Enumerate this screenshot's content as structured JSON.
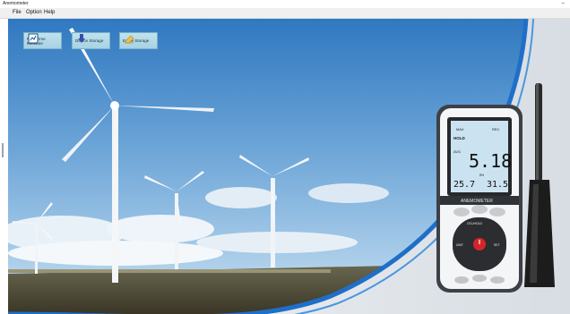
{
  "window": {
    "title": "Anemometer",
    "minimize_glyph": "–"
  },
  "menu": [
    {
      "label": "File"
    },
    {
      "label": "Option"
    },
    {
      "label": "Help"
    }
  ],
  "toolbar": [
    {
      "label": "Real Time Measure",
      "icon": "realtime-measure-icon"
    },
    {
      "label": "Device Storage",
      "icon": "device-storage-icon"
    },
    {
      "label": "Erase Storage",
      "icon": "erase-storage-icon"
    }
  ],
  "device": {
    "brand": "ANEMOMETER",
    "primary_reading": "5.18",
    "temperature_reading": "25.7",
    "secondary_reading": "31.5",
    "labels": {
      "max": "MAX",
      "rec": "REC",
      "avg": "AVG",
      "hold": "HOLD",
      "rh": "RH"
    },
    "buttons": {
      "cel_hold": "CEL/HOLD",
      "unit": "UNIT",
      "dir_btn": "SET"
    }
  },
  "colors": {
    "sky_top": "#3d83c6",
    "sky_bottom": "#bcdaf0",
    "swoosh": "#1f6fc8",
    "toolbar_bg": "#b4dbea"
  }
}
